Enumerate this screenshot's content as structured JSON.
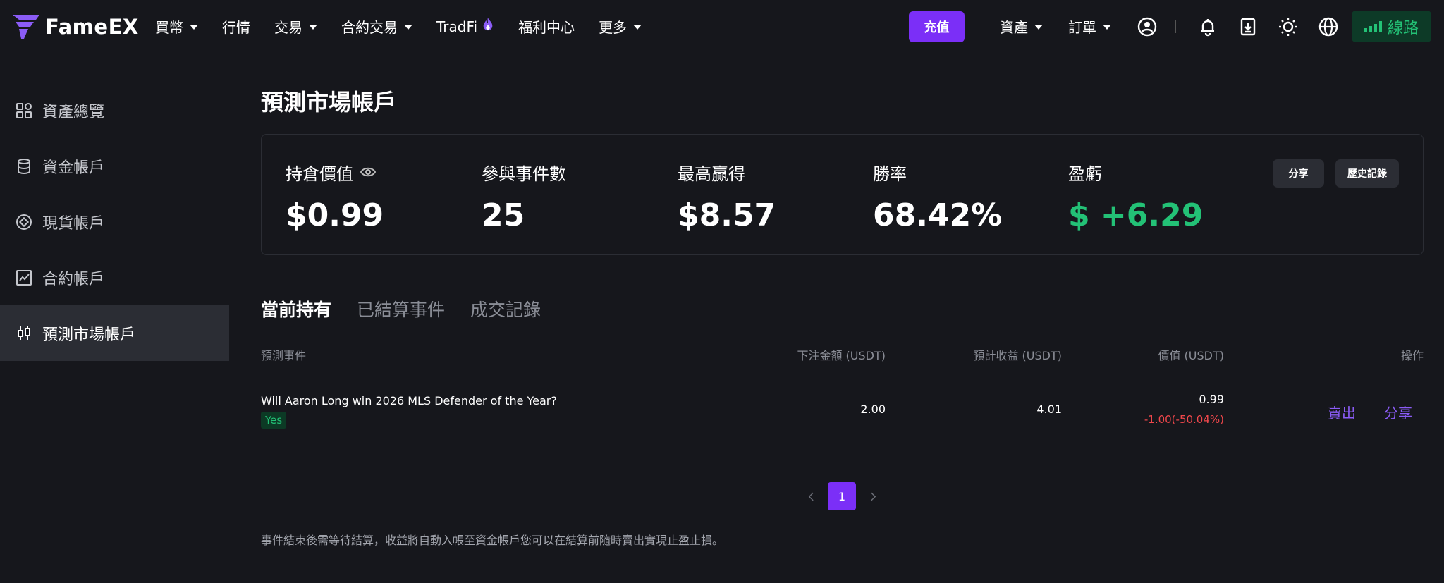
{
  "brand": {
    "name": "FameEX"
  },
  "nav": {
    "items": [
      {
        "label": "買幣",
        "caret": true
      },
      {
        "label": "行情",
        "caret": false
      },
      {
        "label": "交易",
        "caret": true
      },
      {
        "label": "合約交易",
        "caret": true
      },
      {
        "label": "TradFi",
        "caret": false,
        "badge": "fire-icon"
      },
      {
        "label": "福利中心",
        "caret": false
      },
      {
        "label": "更多",
        "caret": true
      }
    ],
    "recharge": "充值",
    "assets": "資產",
    "orders": "訂單",
    "line_label": "線路"
  },
  "sidebar": {
    "items": [
      {
        "label": "資產總覽",
        "icon": "grid-icon"
      },
      {
        "label": "資金帳戶",
        "icon": "database-icon"
      },
      {
        "label": "現貨帳戶",
        "icon": "spot-icon"
      },
      {
        "label": "合約帳戶",
        "icon": "chart-icon"
      },
      {
        "label": "預測市場帳戶",
        "icon": "candlestick-icon",
        "active": true
      }
    ]
  },
  "page": {
    "title": "預測市場帳戶"
  },
  "stats": {
    "position_value": {
      "label": "持倉價值",
      "value": "$0.99"
    },
    "events": {
      "label": "參與事件數",
      "value": "25"
    },
    "max_win": {
      "label": "最高贏得",
      "value": "$8.57"
    },
    "win_rate": {
      "label": "勝率",
      "value": "68.42%"
    },
    "pnl": {
      "label": "盈虧",
      "value": "$ +6.29"
    },
    "share_button": "分享",
    "history_button": "歷史記錄"
  },
  "tabs": [
    "當前持有",
    "已結算事件",
    "成交記錄"
  ],
  "table": {
    "headers": {
      "event": "預測事件",
      "amount": "下注金額 (USDT)",
      "expected": "預計收益 (USDT)",
      "value": "價值 (USDT)",
      "action": "操作"
    },
    "rows": [
      {
        "event": "Will Aaron Long win 2026 MLS Defender of the Year?",
        "outcome": "Yes",
        "amount": "2.00",
        "expected": "4.01",
        "value": "0.99",
        "change": "-1.00(-50.04%)",
        "sell": "賣出",
        "share": "分享"
      }
    ]
  },
  "pagination": {
    "current": "1"
  },
  "footnote": "事件結束後需等待結算，收益將自動入帳至資金帳戶您可以在結算前隨時賣出實現止盈止損。",
  "colors": {
    "accent": "#7b2ff7",
    "positive": "#23c176",
    "negative": "#f0474b",
    "background": "#16171c"
  }
}
